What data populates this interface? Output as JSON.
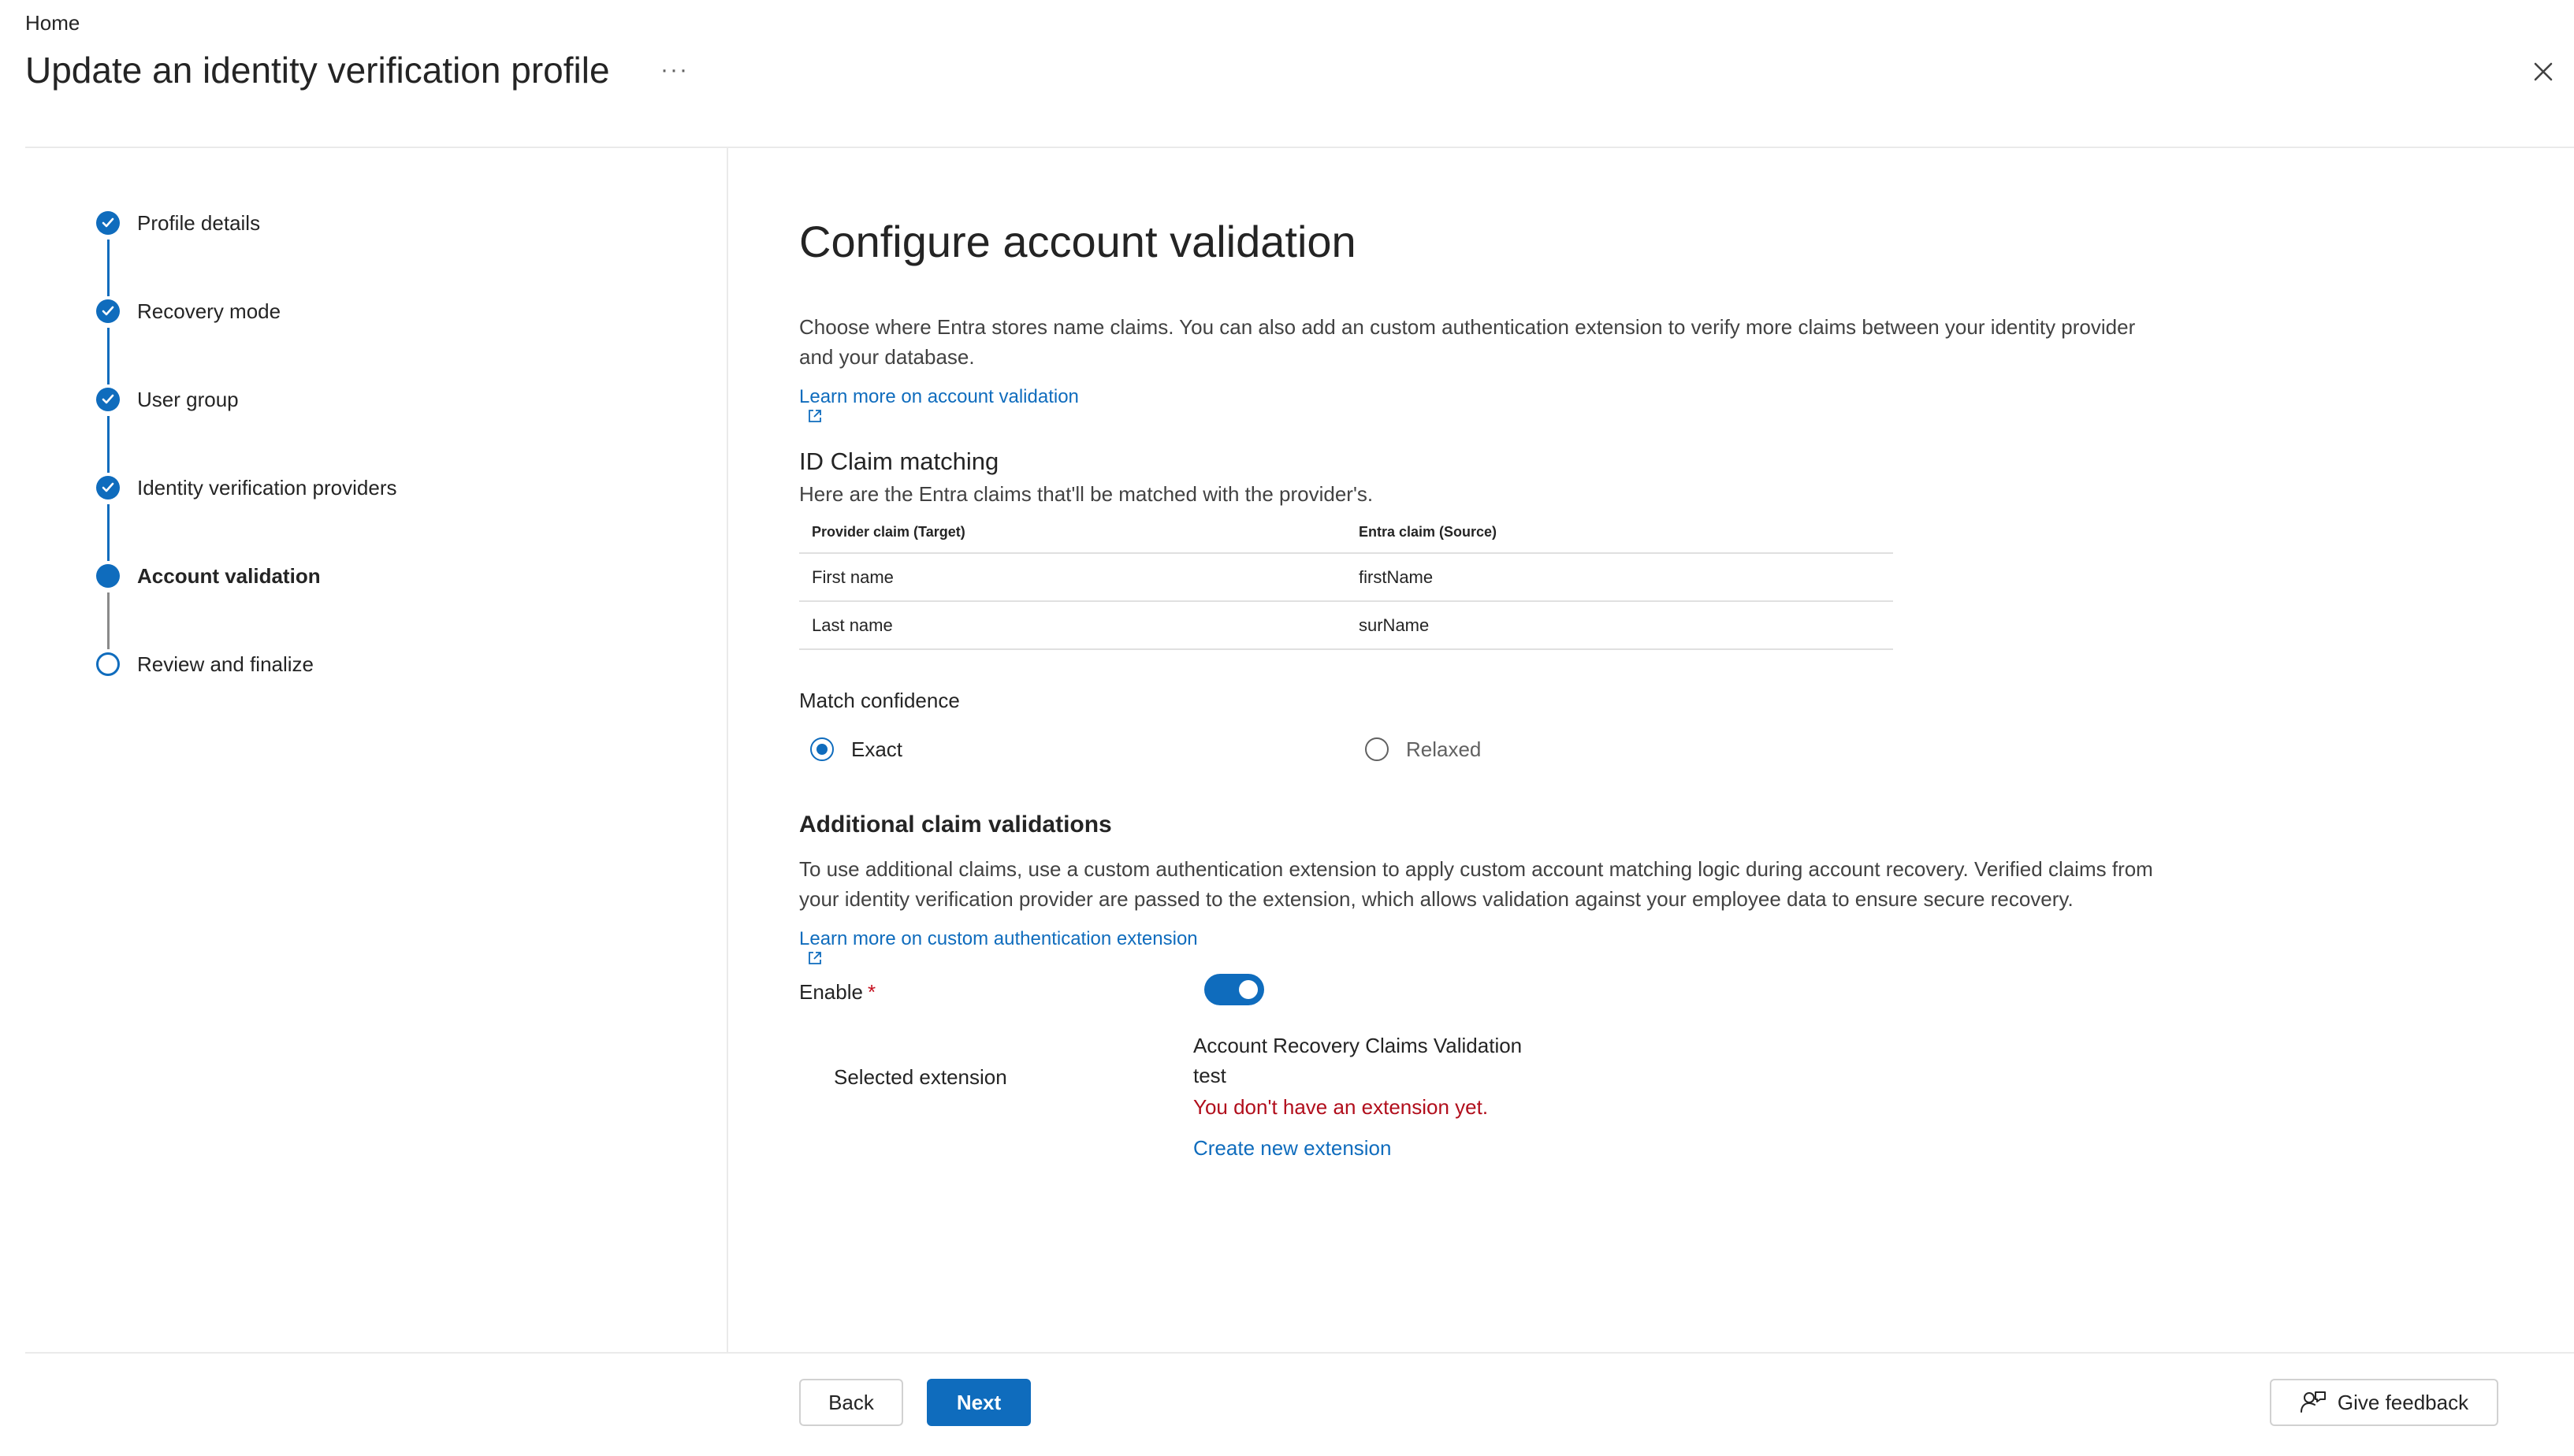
{
  "header": {
    "breadcrumb": "Home",
    "title": "Update an identity verification profile",
    "more_label": "···"
  },
  "stepper": {
    "steps": [
      {
        "label": "Profile details",
        "state": "done"
      },
      {
        "label": "Recovery mode",
        "state": "done"
      },
      {
        "label": "User group",
        "state": "done"
      },
      {
        "label": "Identity verification providers",
        "state": "done"
      },
      {
        "label": "Account validation",
        "state": "current"
      },
      {
        "label": "Review and finalize",
        "state": "future"
      }
    ]
  },
  "main": {
    "heading": "Configure account validation",
    "description": "Choose where Entra stores name claims. You can also add an custom authentication extension to verify more claims between your identity provider and your database.",
    "learn_link": "Learn more on account validation",
    "id_claim": {
      "heading": "ID Claim matching",
      "subtitle": "Here are the Entra claims that'll be matched with the provider's.",
      "columns": [
        "Provider claim (Target)",
        "Entra claim (Source)"
      ],
      "rows": [
        [
          "First name",
          "firstName"
        ],
        [
          "Last name",
          "surName"
        ]
      ]
    },
    "match_confidence": {
      "label": "Match confidence",
      "options": [
        "Exact",
        "Relaxed"
      ],
      "selected": "Exact"
    },
    "additional": {
      "heading": "Additional claim validations",
      "description": "To use additional claims, use a custom authentication extension to apply custom account matching logic during account recovery. Verified claims from your identity verification provider are passed to the extension, which allows validation against your employee data to ensure secure recovery.",
      "learn_link": "Learn more on custom authentication extension",
      "enable_label": "Enable",
      "required_mark": "*",
      "enabled": true,
      "selected_extension_label": "Selected extension",
      "extension_name": "Account Recovery Claims Validation",
      "extension_value": "test",
      "error_text": "You don't have an extension yet.",
      "create_link": "Create new extension"
    }
  },
  "footer": {
    "back_label": "Back",
    "next_label": "Next",
    "feedback_label": "Give feedback"
  },
  "colors": {
    "accent": "#0f6cbd",
    "error": "#b10e1c",
    "text": "#242424"
  }
}
